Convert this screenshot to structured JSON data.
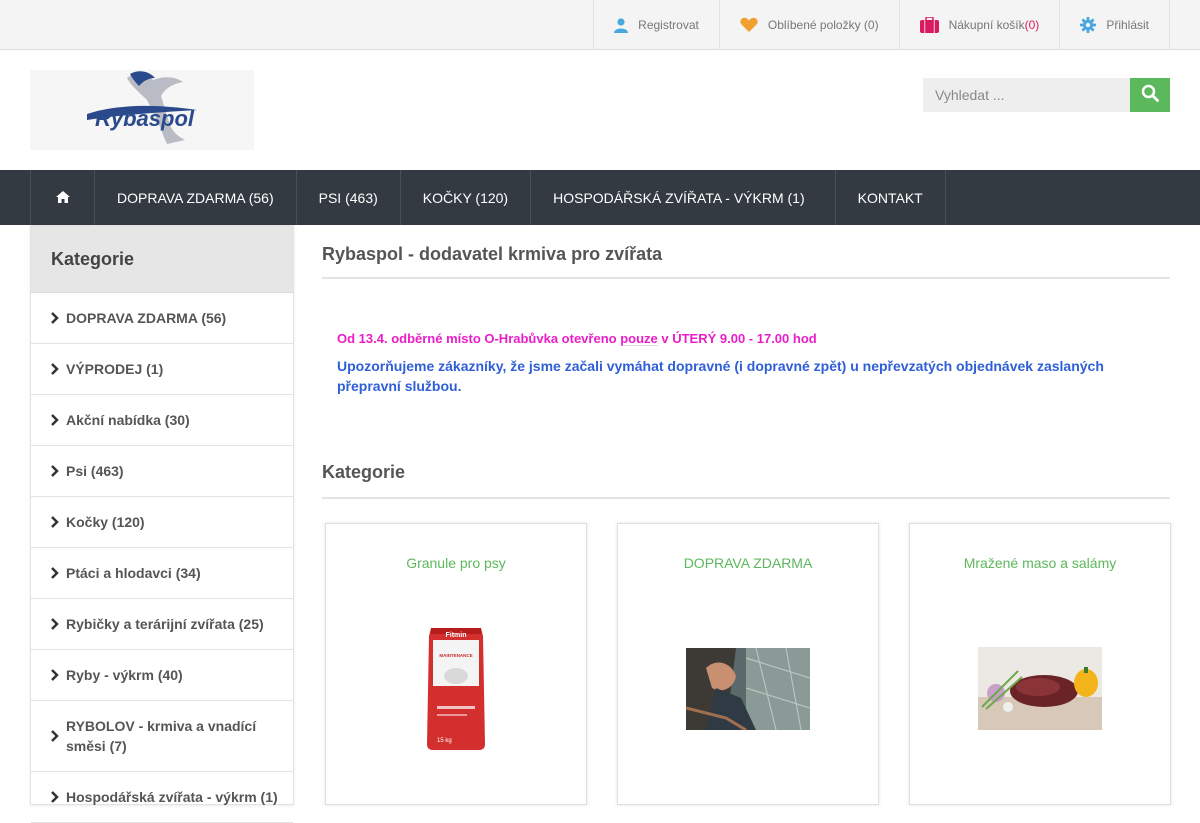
{
  "topbar": {
    "register": "Registrovat",
    "favorites": "Oblíbené položky (0)",
    "cart_label": "Nákupní košík ",
    "cart_count": "(0)",
    "login": "Přihlásit"
  },
  "logo": {
    "text": "Rybaspol"
  },
  "search": {
    "placeholder": "Vyhledat ..."
  },
  "nav": {
    "items": [
      "DOPRAVA ZDARMA (56)",
      "PSI (463)",
      "KOČKY (120)",
      "HOSPODÁŘSKÁ ZVÍŘATA - VÝKRM (1)",
      "KONTAKT"
    ]
  },
  "sidebar": {
    "title": "Kategorie",
    "items": [
      "DOPRAVA ZDARMA (56)",
      "VÝPRODEJ (1)",
      "Akční nabídka (30)",
      "Psi (463)",
      "Kočky (120)",
      "Ptáci a hlodavci (34)",
      "Rybičky a terárijní zvířata (25)",
      "Ryby - výkrm (40)",
      "RYBOLOV - krmiva a vnadící směsi (7)",
      "Hospodářská zvířata - výkrm (1)"
    ]
  },
  "main": {
    "title": "Rybaspol - dodavatel krmiva pro zvířata",
    "notice1_a": "Od 13.4. odběrné místo O-Hrabůvka otevřeno ",
    "notice1_b": "pouze",
    "notice1_c": " v ÚTERÝ 9.00 - 17.00 hod",
    "notice2": "Upozorňujeme zákazníky, že jsme začali vymáhat dopravné (i dopravné zpět) u nepřevzatých objednávek zaslaných přepravní službou.",
    "section_title": "Kategorie",
    "cards": [
      {
        "title": "Granule pro psy",
        "bag_brand": "Fitmin",
        "bag_text": "MAINTENANCE",
        "bag_weight": "15 kg"
      },
      {
        "title": "DOPRAVA ZDARMA"
      },
      {
        "title": "Mražené maso a salámy"
      }
    ]
  },
  "colors": {
    "accent": "#5cb85c",
    "nav_bg": "#343a42",
    "notice_pink": "#e91ec8",
    "notice_blue": "#2f5fd6"
  }
}
